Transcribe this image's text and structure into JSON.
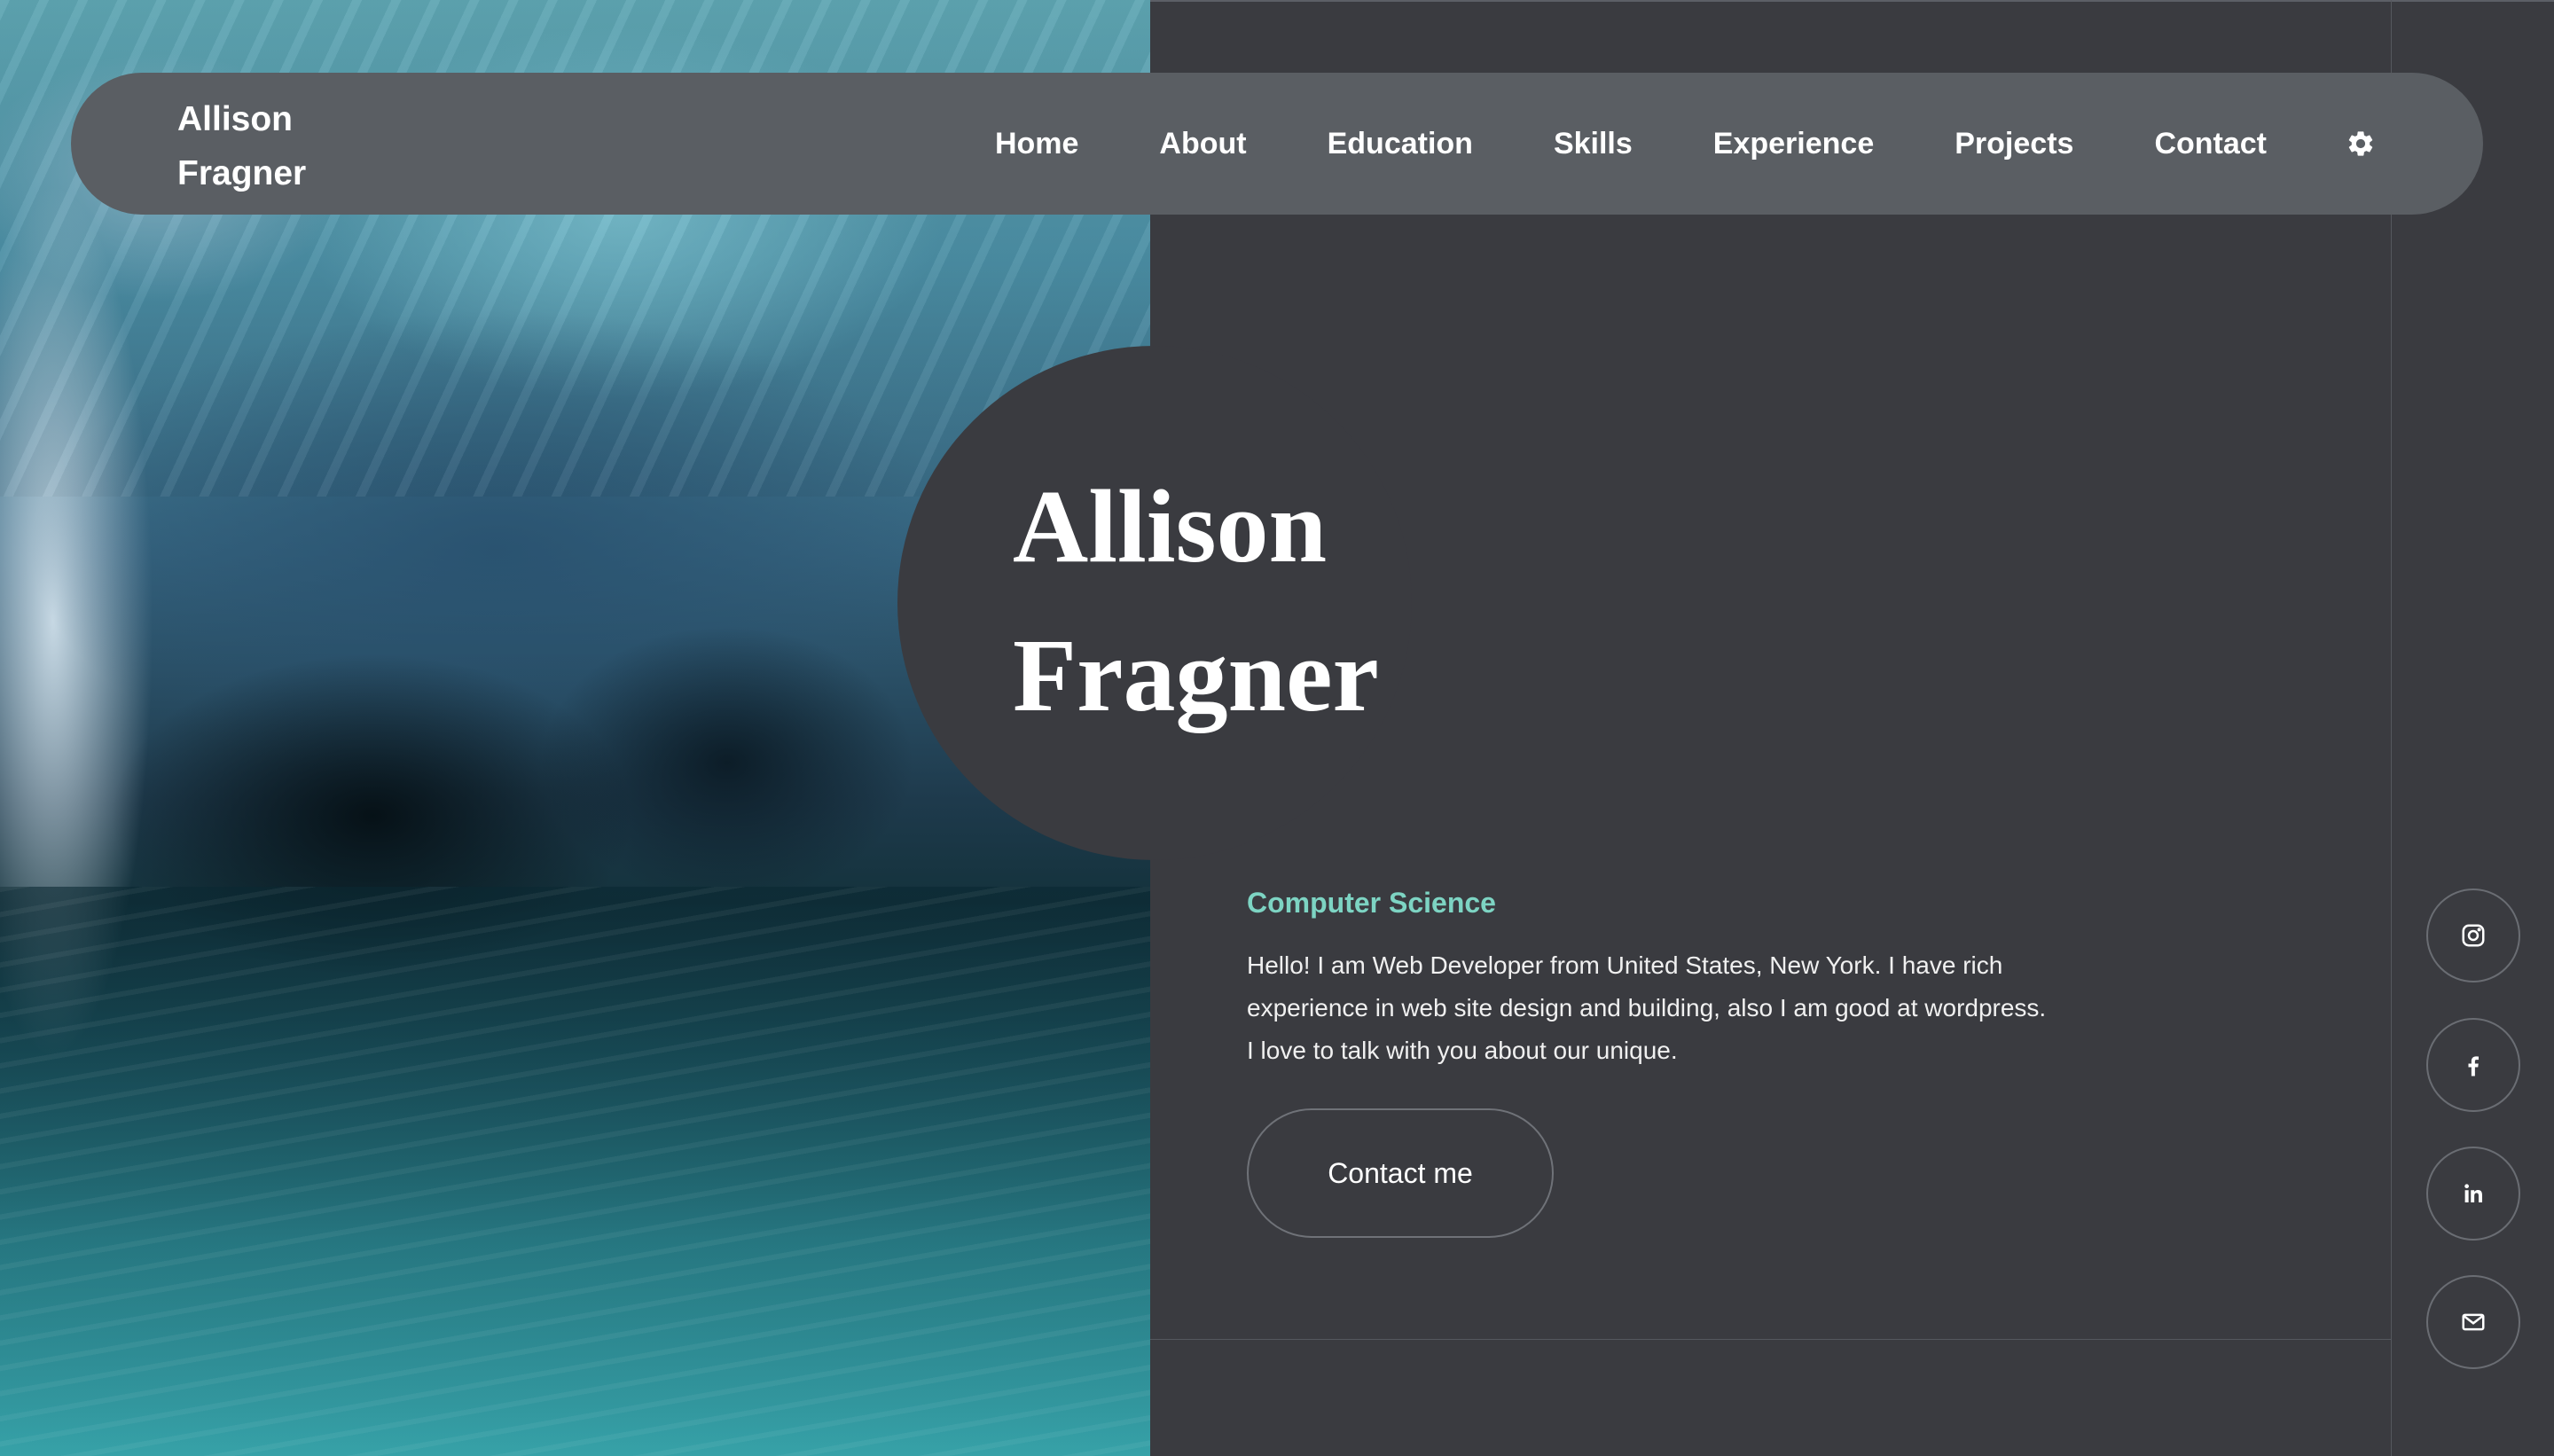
{
  "brand": {
    "line1": "Allison",
    "line2": "Fragner"
  },
  "nav": {
    "items": [
      {
        "label": "Home"
      },
      {
        "label": "About"
      },
      {
        "label": "Education"
      },
      {
        "label": "Skills"
      },
      {
        "label": "Experience"
      },
      {
        "label": "Projects"
      },
      {
        "label": "Contact"
      }
    ],
    "settings_icon": "gear-icon"
  },
  "hero": {
    "name_line1": "Allison",
    "name_line2": "Fragner",
    "subtitle": "Computer Science",
    "intro_line1": "Hello! I am Web Developer from United States, New York. I have rich",
    "intro_line2": "experience in web site design and building, also I am good at wordpress.",
    "intro_line3": "I love to talk with you about our unique.",
    "cta_label": "Contact me"
  },
  "social": [
    {
      "icon": "instagram-icon"
    },
    {
      "icon": "facebook-icon"
    },
    {
      "icon": "linkedin-icon"
    },
    {
      "icon": "email-icon"
    }
  ],
  "colors": {
    "background": "#3a3b40",
    "navbar": "#5a5e63",
    "accent": "#7dd4c3",
    "text": "#ffffff"
  }
}
